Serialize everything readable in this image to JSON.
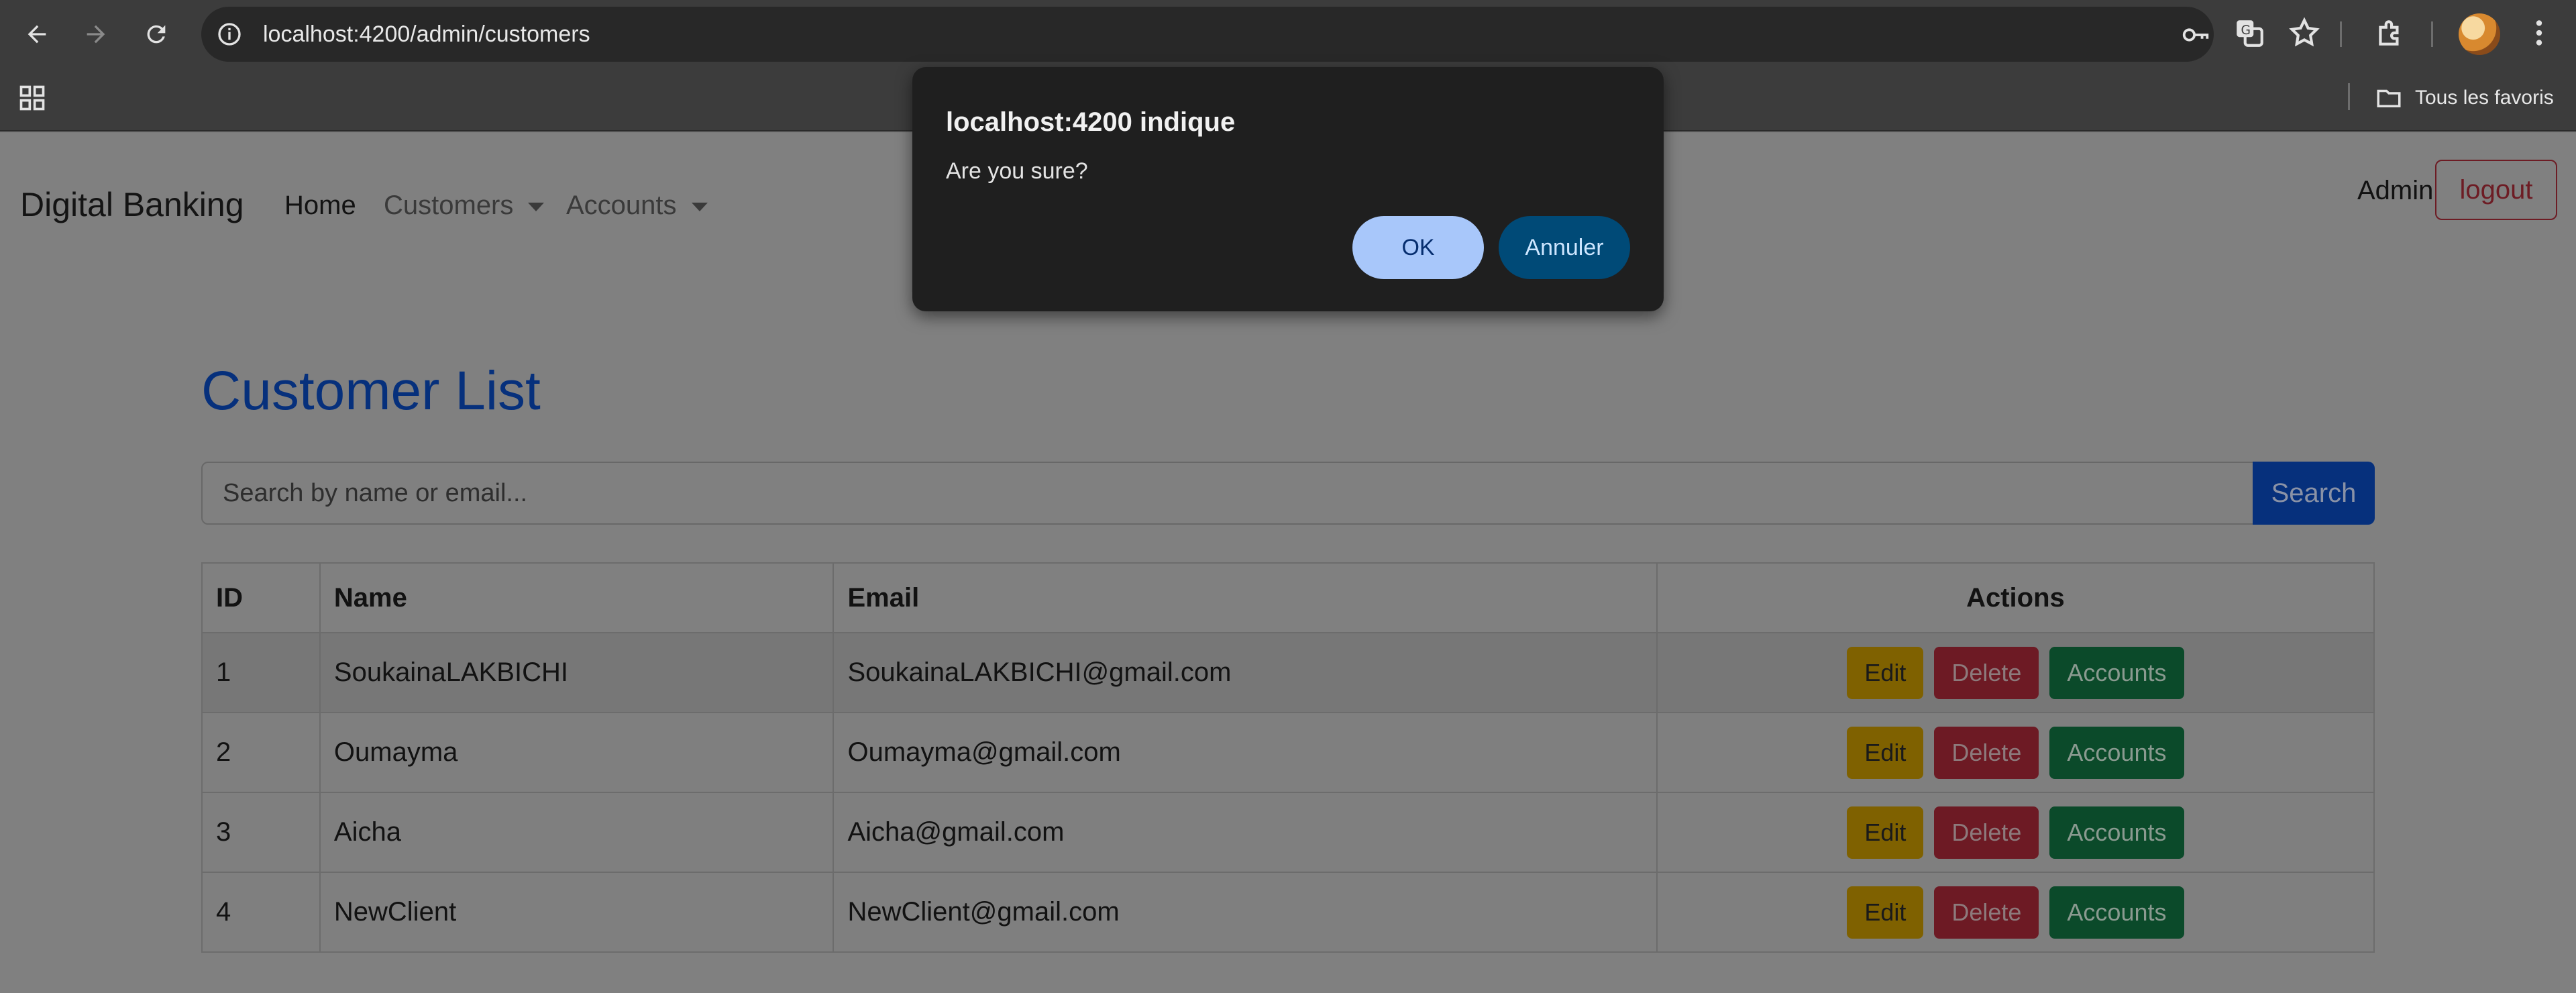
{
  "browser": {
    "url": "localhost:4200/admin/customers",
    "bookmark_folder": "Tous les favoris",
    "colors": {
      "chrome": "#3c3c3c",
      "omnibox": "#282828"
    }
  },
  "navbar": {
    "brand": "Digital Banking",
    "links": [
      "Home",
      "Customers",
      "Accounts"
    ],
    "user": "Admin",
    "logout_label": "logout"
  },
  "main": {
    "title": "Customer List",
    "search": {
      "placeholder": "Search by name or email...",
      "button_label": "Search"
    },
    "table": {
      "headers": [
        "ID",
        "Name",
        "Email",
        "Actions"
      ],
      "rows": [
        {
          "id": "1",
          "name": "SoukainaLAKBICHI",
          "email": "SoukainaLAKBICHI@gmail.com"
        },
        {
          "id": "2",
          "name": "Oumayma",
          "email": "Oumayma@gmail.com"
        },
        {
          "id": "3",
          "name": "Aicha",
          "email": "Aicha@gmail.com"
        },
        {
          "id": "4",
          "name": "NewClient",
          "email": "NewClient@gmail.com"
        }
      ],
      "action_labels": {
        "edit": "Edit",
        "delete": "Delete",
        "accounts": "Accounts"
      }
    }
  },
  "dialog": {
    "title": "localhost:4200 indique",
    "message": "Are you sure?",
    "ok_label": "OK",
    "cancel_label": "Annuler"
  },
  "colors": {
    "primary": "#0d6efd",
    "warning": "#ffc107",
    "danger": "#dc3545",
    "success": "#198754",
    "dialog_bg": "#1f1f1f",
    "dialog_ok": "#a8c7fa",
    "dialog_cancel": "#004a77"
  }
}
